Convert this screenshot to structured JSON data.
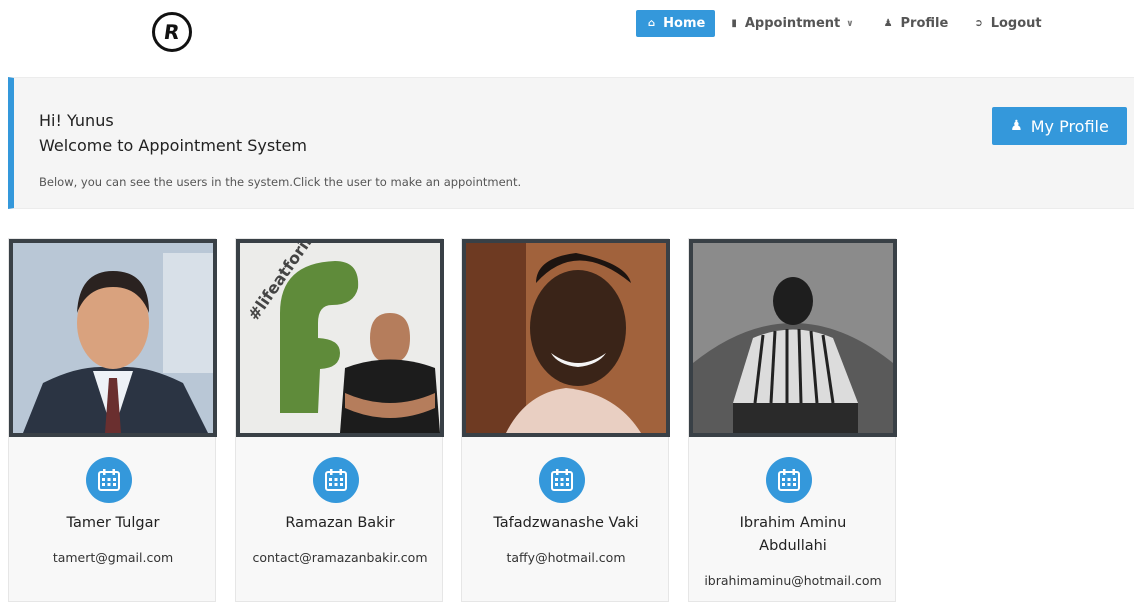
{
  "nav": {
    "logo_letter": "R",
    "items": [
      {
        "label": "Home",
        "icon": "home-icon",
        "active": true
      },
      {
        "label": "Appointment",
        "icon": "book-icon",
        "has_dropdown": true
      },
      {
        "label": "Profile",
        "icon": "user-icon"
      },
      {
        "label": "Logout",
        "icon": "logout-icon"
      }
    ]
  },
  "banner": {
    "greeting": "Hi! Yunus",
    "welcome": "Welcome to Appointment System",
    "description": "Below, you can see the users in the system.Click the user to make an appointment.",
    "my_profile_label": "My Profile"
  },
  "colors": {
    "accent": "#3498db",
    "photo_frame": "#394046"
  },
  "users": [
    {
      "name": "Tamer Tulgar",
      "email": "tamert@gmail.com"
    },
    {
      "name": "Ramazan Bakir",
      "email": "contact@ramazanbakir.com",
      "photo_text": "#lifeatforiba"
    },
    {
      "name": "Tafadzwanashe Vaki",
      "email": "taffy@hotmail.com"
    },
    {
      "name": "Ibrahim Aminu Abdullahi",
      "email": "ibrahimaminu@hotmail.com"
    }
  ]
}
